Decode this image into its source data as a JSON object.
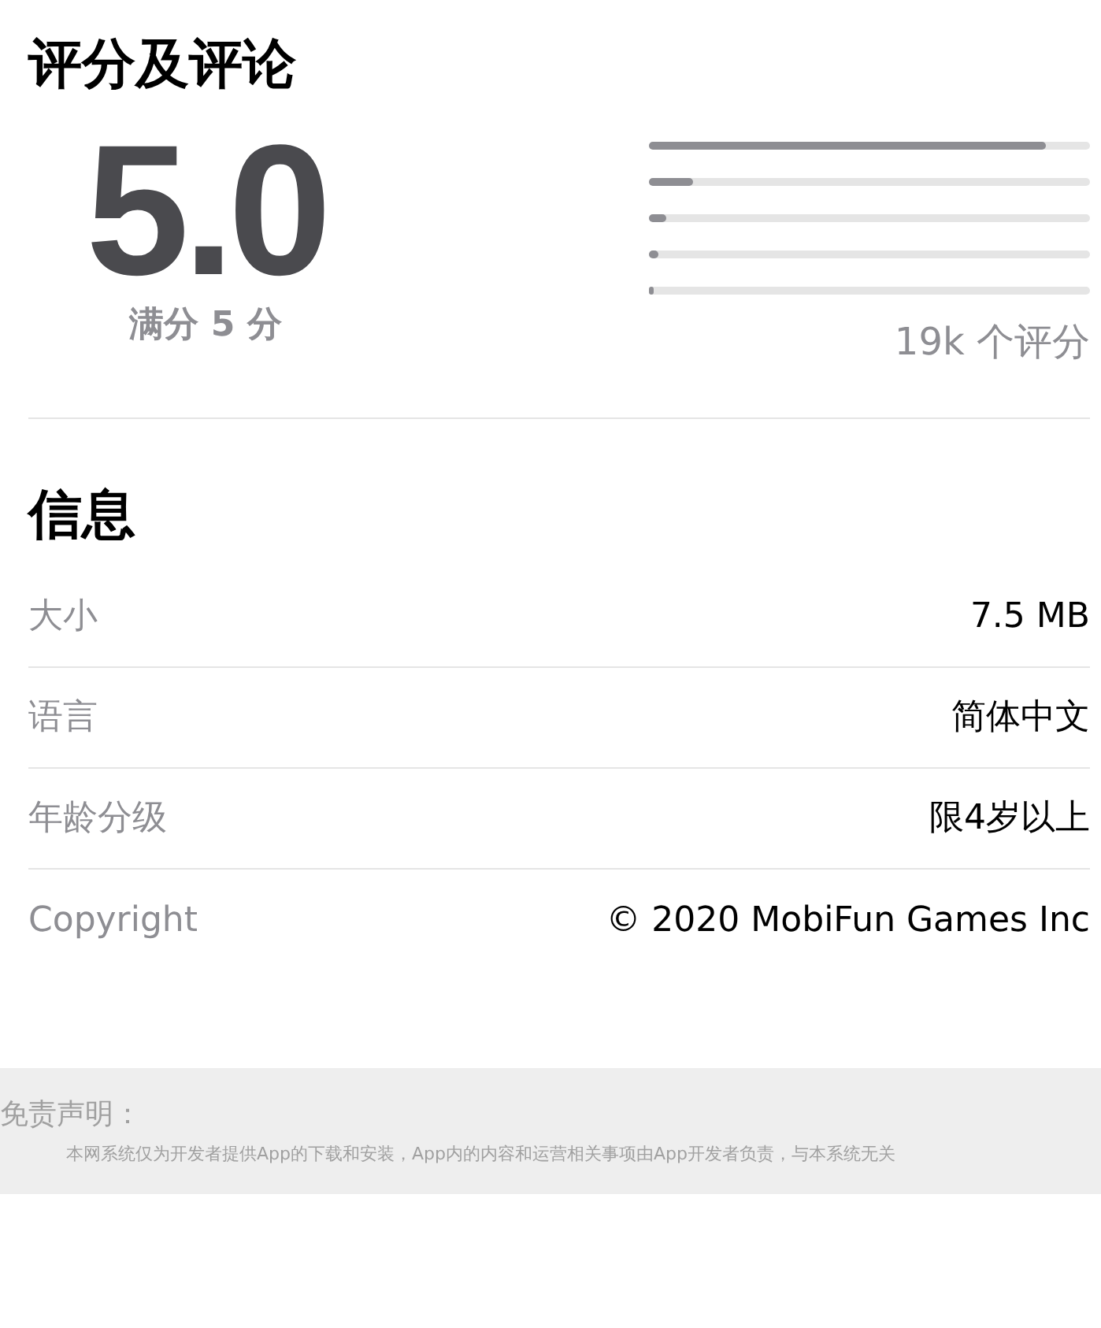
{
  "ratings": {
    "title": "评分及评论",
    "score": "5.0",
    "out_of": "满分 5 分",
    "bars": [
      {
        "level": 0.9
      },
      {
        "level": 0.1
      },
      {
        "level": 0.04
      },
      {
        "level": 0.02
      },
      {
        "level": 0.01
      }
    ],
    "count": "19k 个评分"
  },
  "info": {
    "title": "信息",
    "rows": [
      {
        "label": "大小",
        "value": "7.5 MB"
      },
      {
        "label": "语言",
        "value": "简体中文"
      },
      {
        "label": "年龄分级",
        "value": "限4岁以上"
      },
      {
        "label": "Copyright",
        "value": "© 2020 MobiFun Games Inc"
      }
    ]
  },
  "disclaimer": {
    "title": "免责声明：",
    "text": "本网系统仅为开发者提供App的下载和安装，App内的内容和运营相关事项由App开发者负责，与本系统无关"
  }
}
